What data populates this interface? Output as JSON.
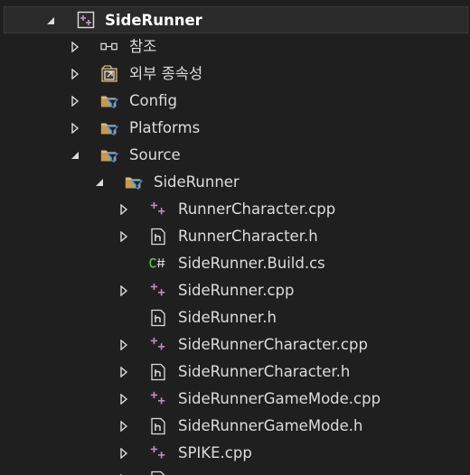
{
  "solution_explorer": {
    "items": [
      {
        "label": "SideRunner",
        "icon": "cpp-project-icon",
        "expander": "expanded",
        "selected": true
      },
      {
        "label": "참조",
        "icon": "references-icon",
        "expander": "collapsed"
      },
      {
        "label": "외부 종속성",
        "icon": "external-dependencies-icon",
        "expander": "collapsed"
      },
      {
        "label": "Config",
        "icon": "filter-folder-icon",
        "expander": "collapsed"
      },
      {
        "label": "Platforms",
        "icon": "filter-folder-icon",
        "expander": "collapsed"
      },
      {
        "label": "Source",
        "icon": "filter-folder-icon",
        "expander": "expanded"
      },
      {
        "label": "SideRunner",
        "icon": "filter-folder-icon",
        "expander": "expanded"
      },
      {
        "label": "RunnerCharacter.cpp",
        "icon": "cpp-file-icon",
        "expander": "collapsed"
      },
      {
        "label": "RunnerCharacter.h",
        "icon": "header-file-icon",
        "expander": "collapsed"
      },
      {
        "label": "SideRunner.Build.cs",
        "icon": "csharp-file-icon",
        "expander": "none"
      },
      {
        "label": "SideRunner.cpp",
        "icon": "cpp-file-icon",
        "expander": "collapsed"
      },
      {
        "label": "SideRunner.h",
        "icon": "header-file-icon",
        "expander": "none"
      },
      {
        "label": "SideRunnerCharacter.cpp",
        "icon": "cpp-file-icon",
        "expander": "collapsed"
      },
      {
        "label": "SideRunnerCharacter.h",
        "icon": "header-file-icon",
        "expander": "collapsed"
      },
      {
        "label": "SideRunnerGameMode.cpp",
        "icon": "cpp-file-icon",
        "expander": "collapsed"
      },
      {
        "label": "SideRunnerGameMode.h",
        "icon": "header-file-icon",
        "expander": "collapsed"
      },
      {
        "label": "SPIKE.cpp",
        "icon": "cpp-file-icon",
        "expander": "collapsed"
      }
    ]
  },
  "colors": {
    "background": "#1f1f1f",
    "text": "#dcdcdc",
    "cpp_icon": "#c586c0",
    "csharp_icon": "#4ec94e",
    "folder": "#dcb67a",
    "filter": "#3794ff"
  }
}
